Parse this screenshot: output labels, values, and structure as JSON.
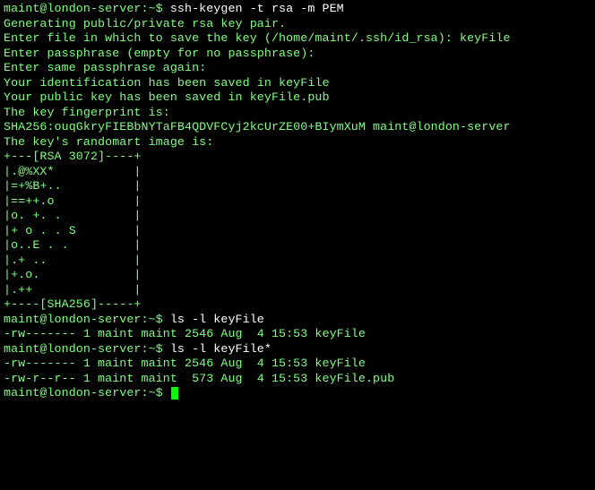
{
  "session": {
    "user": "maint",
    "host": "london-server",
    "prompt_suffix": ":~$ "
  },
  "lines": [
    {
      "type": "cmd",
      "prompt": "maint@london-server:~$ ",
      "command": "ssh-keygen -t rsa -m PEM"
    },
    {
      "type": "out",
      "text": "Generating public/private rsa key pair."
    },
    {
      "type": "out",
      "text": "Enter file in which to save the key (/home/maint/.ssh/id_rsa): keyFile"
    },
    {
      "type": "out",
      "text": "Enter passphrase (empty for no passphrase):"
    },
    {
      "type": "out",
      "text": "Enter same passphrase again:"
    },
    {
      "type": "out",
      "text": "Your identification has been saved in keyFile"
    },
    {
      "type": "out",
      "text": "Your public key has been saved in keyFile.pub"
    },
    {
      "type": "out",
      "text": "The key fingerprint is:"
    },
    {
      "type": "out",
      "text": "SHA256:ouqGkryFIEBbNYTaFB4QDVFCyj2kcUrZE00+BIymXuM maint@london-server"
    },
    {
      "type": "out",
      "text": "The key's randomart image is:"
    },
    {
      "type": "out",
      "text": "+---[RSA 3072]----+"
    },
    {
      "type": "out",
      "text": "|.@%XX*           |"
    },
    {
      "type": "out",
      "text": "|=+%B+..          |"
    },
    {
      "type": "out",
      "text": "|==++.o           |"
    },
    {
      "type": "out",
      "text": "|o. +. .          |"
    },
    {
      "type": "out",
      "text": "|+ o . . S        |"
    },
    {
      "type": "out",
      "text": "|o..E . .         |"
    },
    {
      "type": "out",
      "text": "|.+ ..            |"
    },
    {
      "type": "out",
      "text": "|+.o.             |"
    },
    {
      "type": "out",
      "text": "|.++              |"
    },
    {
      "type": "out",
      "text": "+----[SHA256]-----+"
    },
    {
      "type": "cmd",
      "prompt": "maint@london-server:~$ ",
      "command": "ls -l keyFile"
    },
    {
      "type": "out",
      "text": "-rw------- 1 maint maint 2546 Aug  4 15:53 keyFile"
    },
    {
      "type": "cmd",
      "prompt": "maint@london-server:~$ ",
      "command": "ls -l keyFile*"
    },
    {
      "type": "out",
      "text": "-rw------- 1 maint maint 2546 Aug  4 15:53 keyFile"
    },
    {
      "type": "out",
      "text": "-rw-r--r-- 1 maint maint  573 Aug  4 15:53 keyFile.pub"
    },
    {
      "type": "prompt_cursor",
      "prompt": "maint@london-server:~$ "
    }
  ]
}
